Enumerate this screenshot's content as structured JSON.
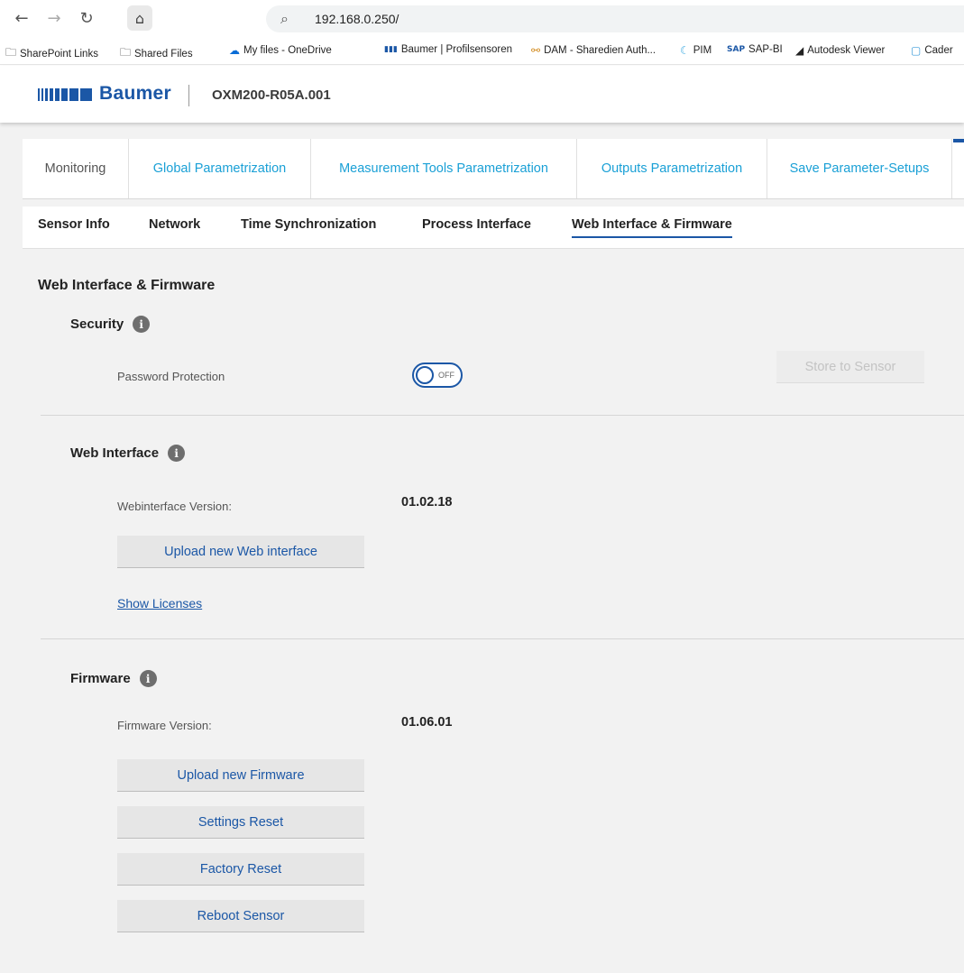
{
  "browser": {
    "address": "192.168.0.250/",
    "bookmarks": [
      {
        "label": "SharePoint Links",
        "icon": "folder-icon"
      },
      {
        "label": "Shared Files",
        "icon": "folder-icon"
      },
      {
        "label": "My files - OneDrive",
        "icon": "onedrive-icon"
      },
      {
        "label": "Baumer | Profilsensoren",
        "icon": "baumer-icon"
      },
      {
        "label": "DAM - Sharedien Auth...",
        "icon": "dam-icon"
      },
      {
        "label": "PIM",
        "icon": "pim-icon"
      },
      {
        "label": "SAP-BI",
        "icon": "sap-icon"
      },
      {
        "label": "Autodesk Viewer",
        "icon": "autodesk-icon"
      },
      {
        "label": "Cader",
        "icon": "cadenas-icon"
      }
    ]
  },
  "header": {
    "brand": "Baumer",
    "device": "OXM200-R05A.001",
    "brand_color": "#1b57a6"
  },
  "tabs": [
    {
      "label": "Monitoring",
      "active": true
    },
    {
      "label": "Global Parametrization",
      "active": false
    },
    {
      "label": "Measurement Tools Parametrization",
      "active": false
    },
    {
      "label": "Outputs Parametrization",
      "active": false
    },
    {
      "label": "Save Parameter-Setups",
      "active": false
    }
  ],
  "subnav": [
    {
      "label": "Sensor Info",
      "active": false
    },
    {
      "label": "Network",
      "active": false
    },
    {
      "label": "Time Synchronization",
      "active": false
    },
    {
      "label": "Process Interface",
      "active": false
    },
    {
      "label": "Web Interface & Firmware",
      "active": true
    }
  ],
  "page": {
    "title": "Web Interface & Firmware",
    "security": {
      "title": "Security",
      "password_label": "Password Protection",
      "toggle_state": "OFF",
      "store_button": "Store to Sensor"
    },
    "web_interface": {
      "title": "Web Interface",
      "version_label": "Webinterface Version:",
      "version_value": "01.02.18",
      "upload_button": "Upload new Web interface",
      "licenses_link": "Show Licenses"
    },
    "firmware": {
      "title": "Firmware",
      "version_label": "Firmware Version:",
      "version_value": "01.06.01",
      "upload_button": "Upload new Firmware",
      "settings_reset_button": "Settings Reset",
      "factory_reset_button": "Factory Reset",
      "reboot_button": "Reboot Sensor"
    }
  }
}
